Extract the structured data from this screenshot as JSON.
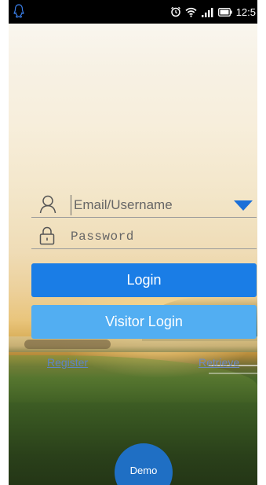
{
  "status_bar": {
    "time": "12:5",
    "icons": [
      "qq-icon",
      "alarm-icon",
      "wifi-icon",
      "signal-icon",
      "battery-icon"
    ]
  },
  "login_form": {
    "username": {
      "placeholder": "Email/Username",
      "value": "",
      "icon": "user-icon"
    },
    "password": {
      "placeholder": "Password",
      "value": "",
      "icon": "lock-icon"
    },
    "dropdown_icon": "dropdown-arrow-icon",
    "login_label": "Login",
    "visitor_login_label": "Visitor Login",
    "register_label": "Register",
    "retrieve_label": "Retrieve"
  },
  "demo": {
    "label": "Demo"
  },
  "colors": {
    "login_button": "#1a7de6",
    "visitor_button": "#52aef2",
    "dropdown_arrow": "#1a6fd8",
    "demo_button": "#1f6fc4",
    "link": "#5e85c6"
  }
}
